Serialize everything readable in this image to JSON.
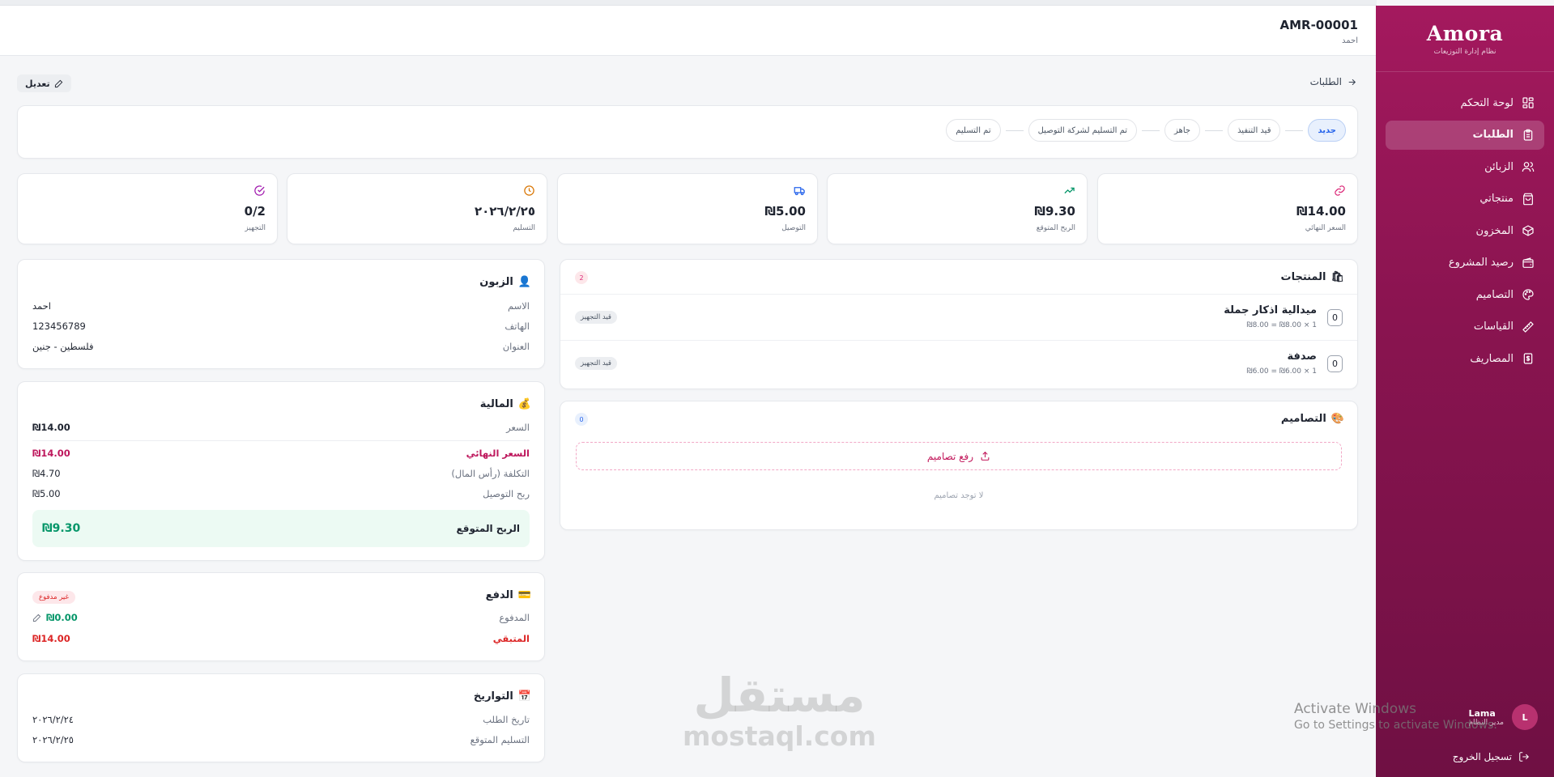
{
  "sidebar": {
    "brand": "Amora",
    "subtitle": "نظام إدارة التوزيعات",
    "items": [
      {
        "label": "لوحة التحكم",
        "icon": "dashboard-icon"
      },
      {
        "label": "الطلبات",
        "icon": "clipboard-icon",
        "active": true
      },
      {
        "label": "الزبائن",
        "icon": "users-icon"
      },
      {
        "label": "منتجاتي",
        "icon": "shopping-bag-icon"
      },
      {
        "label": "المخزون",
        "icon": "box-icon"
      },
      {
        "label": "رصيد المشروع",
        "icon": "wallet-icon"
      },
      {
        "label": "التصاميم",
        "icon": "palette-icon"
      },
      {
        "label": "القياسات",
        "icon": "ruler-icon"
      },
      {
        "label": "المصاريف",
        "icon": "receipt-icon"
      }
    ],
    "user": {
      "initial": "L",
      "name": "Lama",
      "role": "مدير النظام"
    },
    "logout": "تسجيل الخروج"
  },
  "header": {
    "order_code": "AMR-00001",
    "customer": "احمد"
  },
  "back_label": "الطلبات",
  "edit_label": "تعديل",
  "steps": [
    "جديد",
    "قيد التنفيذ",
    "جاهز",
    "تم التسليم لشركة التوصيل",
    "تم التسليم"
  ],
  "stats": [
    {
      "value": "₪14.00",
      "label": "السعر النهائي",
      "icon": "link-icon",
      "color": "#db2777"
    },
    {
      "value": "₪9.30",
      "label": "الربح المتوقع",
      "icon": "trending-up-icon",
      "color": "#059669"
    },
    {
      "value": "₪5.00",
      "label": "التوصيل",
      "icon": "truck-icon",
      "color": "#2563eb"
    },
    {
      "value": "٢٠٢٦/٢/٢٥",
      "label": "التسليم",
      "icon": "clock-icon",
      "color": "#d97706"
    },
    {
      "value": "0/2",
      "label": "التجهيز",
      "icon": "check-circle-icon",
      "color": "#a21caf"
    }
  ],
  "products": {
    "title": "المنتجات",
    "count": "2",
    "items": [
      {
        "qty": "0",
        "name": "ميدالية اذكار جملة",
        "price": "₪8.00 = ₪8.00 × 1",
        "status": "قيد التجهيز"
      },
      {
        "qty": "0",
        "name": "صدفة",
        "price": "₪6.00 = ₪6.00 × 1",
        "status": "قيد التجهيز"
      }
    ]
  },
  "designs": {
    "title": "التصاميم",
    "count": "0",
    "upload": "رفع تصاميم",
    "empty": "لا توجد تصاميم"
  },
  "customer": {
    "title": "الزبون",
    "name_label": "الاسم",
    "name": "احمد",
    "phone_label": "الهاتف",
    "phone": "123456789",
    "address_label": "العنوان",
    "address": "فلسطين - جنين"
  },
  "finance": {
    "title": "المالية",
    "price_label": "السعر",
    "price": "₪14.00",
    "final_label": "السعر النهائي",
    "final": "₪14.00",
    "cost_label": "التكلفة (رأس المال)",
    "cost": "₪4.70",
    "delivery_profit_label": "ربح التوصيل",
    "delivery_profit": "₪5.00",
    "expected_profit_label": "الربح المتوقع",
    "expected_profit": "₪9.30"
  },
  "payment": {
    "title": "الدفع",
    "status": "غير مدفوع",
    "paid_label": "المدفوع",
    "paid": "₪0.00",
    "remaining_label": "المتبقي",
    "remaining": "₪14.00"
  },
  "dates": {
    "title": "التواريخ",
    "order_label": "تاريخ الطلب",
    "order": "٢٠٢٦/٢/٢٤",
    "delivery_label": "التسليم المتوقع",
    "delivery": "٢٠٢٦/٢/٢٥"
  },
  "watermark": {
    "ar": "مستقل",
    "en": "mostaql.com"
  },
  "os_notice": {
    "line1": "Activate Windows",
    "line2": "Go to Settings to activate Windows."
  }
}
